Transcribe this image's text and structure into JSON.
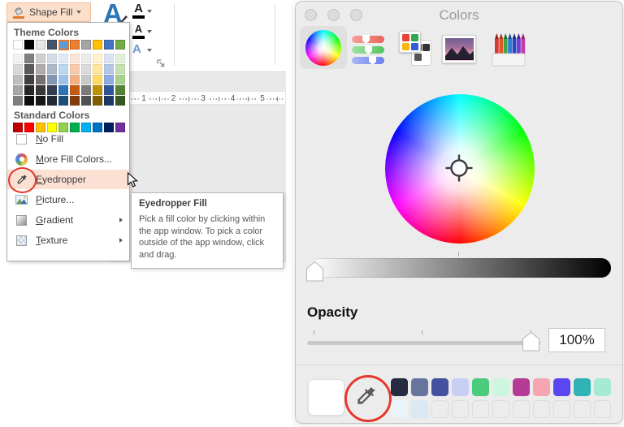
{
  "left_panel": {
    "shape_fill_button": {
      "label": "Shape Fill"
    },
    "wordart_group": {
      "letter": "A"
    },
    "ruler": {
      "numbers": [
        "1",
        "2",
        "3",
        "4",
        "5"
      ]
    },
    "menu": {
      "theme_colors_label": "Theme Colors",
      "standard_colors_label": "Standard Colors",
      "theme_colors": [
        "#FFFFFF",
        "#000000",
        "#E7E6E6",
        "#44546A",
        "#5B9BD5",
        "#ED7D31",
        "#A5A5A5",
        "#FFC000",
        "#4472C4",
        "#70AD47"
      ],
      "selected_theme_index": 4,
      "selection_border_color": "#E8772E",
      "theme_variants": [
        [
          "#F2F2F2",
          "#D9D9D9",
          "#BFBFBF",
          "#A6A6A6",
          "#7F7F7F"
        ],
        [
          "#7F7F7F",
          "#595959",
          "#404040",
          "#262626",
          "#0D0D0D"
        ],
        [
          "#D0CECE",
          "#AFABAB",
          "#767171",
          "#3B3838",
          "#181717"
        ],
        [
          "#D6DCE5",
          "#ACB9CA",
          "#8497B0",
          "#333F50",
          "#222A35"
        ],
        [
          "#DEEBF7",
          "#BDD7EE",
          "#9DC3E6",
          "#2E74B5",
          "#1F4E79"
        ],
        [
          "#FBE5D6",
          "#F8CBAD",
          "#F4B183",
          "#C55A11",
          "#843C0C"
        ],
        [
          "#EDEDED",
          "#DBDBDB",
          "#C9C9C9",
          "#7B7B7B",
          "#525252"
        ],
        [
          "#FFF2CC",
          "#FFE699",
          "#FFD966",
          "#BF9000",
          "#7F6000"
        ],
        [
          "#DAE3F3",
          "#B4C7E7",
          "#8FAADC",
          "#2F5597",
          "#1F3864"
        ],
        [
          "#E2EFDA",
          "#C6E0B4",
          "#A9D18E",
          "#548235",
          "#385723"
        ]
      ],
      "standard_colors": [
        "#C00000",
        "#FF0000",
        "#FFC000",
        "#FFFF00",
        "#92D050",
        "#00B050",
        "#00B0F0",
        "#0070C0",
        "#002060",
        "#7030A0"
      ],
      "highlight_color": "#FBE0D3",
      "items": [
        {
          "name": "no-fill",
          "key": "N",
          "post": "o Fill"
        },
        {
          "name": "more-fill-colors",
          "key": "M",
          "post": "ore Fill Colors..."
        },
        {
          "name": "eyedropper",
          "key": "E",
          "post": "yedropper",
          "highlighted": true
        },
        {
          "name": "picture",
          "key": "P",
          "post": "icture..."
        },
        {
          "name": "gradient",
          "key": "G",
          "post": "radient",
          "submenu": true
        },
        {
          "name": "texture",
          "key": "T",
          "post": "exture",
          "submenu": true
        }
      ]
    },
    "tooltip": {
      "title": "Eyedropper Fill",
      "body": "Pick a fill color by clicking within the app window. To pick a color outside of the app window, click and drag."
    }
  },
  "color_panel": {
    "title": "Colors",
    "tabs": [
      "color-wheel",
      "sliders",
      "palettes",
      "image",
      "pencils"
    ],
    "selected_tab": "color-wheel",
    "opacity": {
      "label": "Opacity",
      "value": "100%"
    },
    "brightness_slider": {
      "min_color": "#FFFFFF",
      "max_color": "#000000"
    },
    "swatches": {
      "current": "#FFFFFF",
      "row1": [
        "#262B41",
        "#67759E",
        "#4450A0",
        "#C8CFF5",
        "#4BCB7C",
        "#CDF6DE",
        "#B53B94",
        "#F6A5B1",
        "#5A47F0",
        "#31B2B7",
        "#A6E9D4"
      ],
      "row2": [
        "#E9F4FB",
        "#D9E8F3",
        null,
        null,
        null,
        null,
        null,
        null,
        null,
        null,
        null
      ]
    }
  },
  "annotation": {
    "circle_color": "#E5392B"
  }
}
